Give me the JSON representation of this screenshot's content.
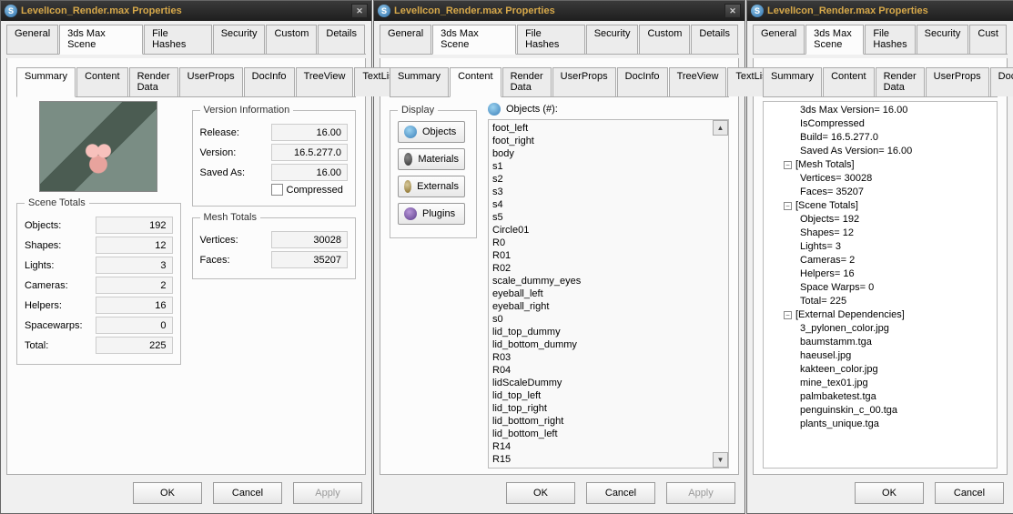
{
  "window_title": "LevelIcon_Render.max Properties",
  "outer_tabs": [
    "General",
    "3ds Max Scene",
    "File Hashes",
    "Security",
    "Custom",
    "Details"
  ],
  "outer_tabs_partial": [
    "General",
    "3ds Max Scene",
    "File Hashes",
    "Security",
    "Cust"
  ],
  "outer_active": "3ds Max Scene",
  "inner_tabs": [
    "Summary",
    "Content",
    "Render Data",
    "UserProps",
    "DocInfo",
    "TreeView",
    "TextList"
  ],
  "inner_tabs_partial": [
    "Summary",
    "Content",
    "Render Data",
    "UserProps",
    "DocInfo",
    "Tre"
  ],
  "buttons": {
    "ok": "OK",
    "cancel": "Cancel",
    "apply": "Apply"
  },
  "summary": {
    "scene_totals_legend": "Scene Totals",
    "scene_totals": [
      {
        "label": "Objects:",
        "value": "192"
      },
      {
        "label": "Shapes:",
        "value": "12"
      },
      {
        "label": "Lights:",
        "value": "3"
      },
      {
        "label": "Cameras:",
        "value": "2"
      },
      {
        "label": "Helpers:",
        "value": "16"
      },
      {
        "label": "Spacewarps:",
        "value": "0"
      },
      {
        "label": "Total:",
        "value": "225"
      }
    ],
    "version_legend": "Version Information",
    "version": [
      {
        "label": "Release:",
        "value": "16.00"
      },
      {
        "label": "Version:",
        "value": "16.5.277.0"
      },
      {
        "label": "Saved As:",
        "value": "16.00"
      }
    ],
    "compressed_label": "Compressed",
    "mesh_legend": "Mesh Totals",
    "mesh": [
      {
        "label": "Vertices:",
        "value": "30028"
      },
      {
        "label": "Faces:",
        "value": "35207"
      }
    ]
  },
  "content": {
    "display_legend": "Display",
    "display_buttons": [
      {
        "name": "objects",
        "label": "Objects"
      },
      {
        "name": "materials",
        "label": "Materials"
      },
      {
        "name": "externals",
        "label": "Externals"
      },
      {
        "name": "plugins",
        "label": "Plugins"
      }
    ],
    "list_title": "Objects (#):",
    "items": [
      "foot_left",
      "foot_right",
      "body",
      "s1",
      "s2",
      "s3",
      "s4",
      "s5",
      "Circle01",
      "R0",
      "R01",
      "R02",
      "scale_dummy_eyes",
      "eyeball_left",
      "eyeball_right",
      "s0",
      "lid_top_dummy",
      "lid_bottom_dummy",
      "R03",
      "R04",
      "lidScaleDummy",
      "lid_top_left",
      "lid_top_right",
      "lid_bottom_right",
      "lid_bottom_left",
      "R14",
      "R15"
    ]
  },
  "tree": {
    "rows": [
      {
        "indent": 2,
        "exp": "",
        "text": "3ds Max Version= 16.00"
      },
      {
        "indent": 2,
        "exp": "",
        "text": "IsCompressed"
      },
      {
        "indent": 2,
        "exp": "",
        "text": "Build= 16.5.277.0"
      },
      {
        "indent": 2,
        "exp": "",
        "text": "Saved As Version= 16.00"
      },
      {
        "indent": 1,
        "exp": "−",
        "text": "[Mesh Totals]"
      },
      {
        "indent": 2,
        "exp": "",
        "text": "Vertices= 30028"
      },
      {
        "indent": 2,
        "exp": "",
        "text": "Faces= 35207"
      },
      {
        "indent": 1,
        "exp": "−",
        "text": "[Scene Totals]"
      },
      {
        "indent": 2,
        "exp": "",
        "text": "Objects= 192"
      },
      {
        "indent": 2,
        "exp": "",
        "text": "Shapes= 12"
      },
      {
        "indent": 2,
        "exp": "",
        "text": "Lights= 3"
      },
      {
        "indent": 2,
        "exp": "",
        "text": "Cameras= 2"
      },
      {
        "indent": 2,
        "exp": "",
        "text": "Helpers= 16"
      },
      {
        "indent": 2,
        "exp": "",
        "text": "Space Warps= 0"
      },
      {
        "indent": 2,
        "exp": "",
        "text": "Total= 225"
      },
      {
        "indent": 1,
        "exp": "−",
        "text": "[External Dependencies]"
      },
      {
        "indent": 2,
        "exp": "",
        "text": "3_pylonen_color.jpg"
      },
      {
        "indent": 2,
        "exp": "",
        "text": "baumstamm.tga"
      },
      {
        "indent": 2,
        "exp": "",
        "text": "haeusel.jpg"
      },
      {
        "indent": 2,
        "exp": "",
        "text": "kakteen_color.jpg"
      },
      {
        "indent": 2,
        "exp": "",
        "text": "mine_tex01.jpg"
      },
      {
        "indent": 2,
        "exp": "",
        "text": "palmbaketest.tga"
      },
      {
        "indent": 2,
        "exp": "",
        "text": "penguinskin_c_00.tga"
      },
      {
        "indent": 2,
        "exp": "",
        "text": "plants_unique.tga"
      }
    ]
  }
}
